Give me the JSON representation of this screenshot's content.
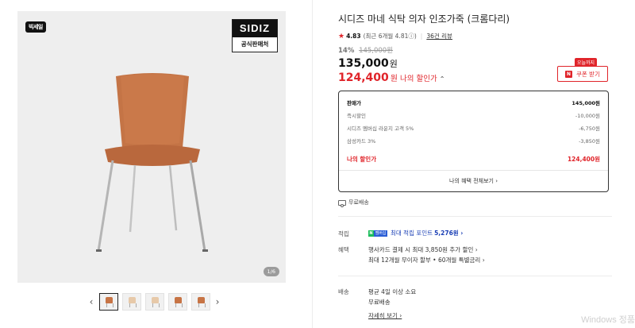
{
  "gallery": {
    "sale_badge": "빅세일",
    "brand_badge": "SIDIZ",
    "brand_badge_sub": "공식판매처",
    "image_counter": "1/6",
    "prev_arrow": "‹",
    "next_arrow": "›"
  },
  "product": {
    "title": "시디즈 마네 식탁 의자 인조가죽 (크롬다리)",
    "rating_score": "4.83",
    "rating_recent": "(최근 6개월 4.81ⓘ)",
    "review_count": "36건 리뷰",
    "discount_pct": "14%",
    "original_price": "145,000원",
    "sale_price": "135,000",
    "sale_price_unit": "원",
    "my_price": "124,400",
    "my_price_unit": "원",
    "my_price_label": "나의 할인가"
  },
  "coupon": {
    "tag": "오늘까지",
    "label": "쿠폰 받기"
  },
  "breakdown": {
    "rows": [
      {
        "label": "판매가",
        "value": "145,000원"
      },
      {
        "label": "즉시할인",
        "value": "-10,000원"
      },
      {
        "label": "시디즈 멤버십 라운지 고객 5%",
        "value": "-6,750원"
      },
      {
        "label": "삼성카드 3%",
        "value": "-3,850원"
      }
    ],
    "my_label": "나의 할인가",
    "my_value": "124,400원",
    "more_label": "나의 혜택 전체보기 ›"
  },
  "shipping_free": "무료배송",
  "details": {
    "points_label": "적립",
    "npay_n": "N",
    "npay_m": "멤버십",
    "points_text": "최대 적립 포인트",
    "points_value": "5,276원 ›",
    "benefit_label": "혜택",
    "benefit_line1": "행사카드 결제 시 최대 3,850원 추가 할인 ›",
    "benefit_line2": "최대 12개월 무이자 할부 • 60개월 특별금리 ›",
    "delivery_label": "배송",
    "delivery_line1": "평균 4일 이상 소요",
    "delivery_line2": "무료배송",
    "delivery_more": "자세히 보기 ›"
  },
  "watermark": "Windows 정품",
  "colors": {
    "accent_red": "#e0242a",
    "points_blue": "#1a3fb5",
    "npay_green": "#1cbd5c"
  }
}
